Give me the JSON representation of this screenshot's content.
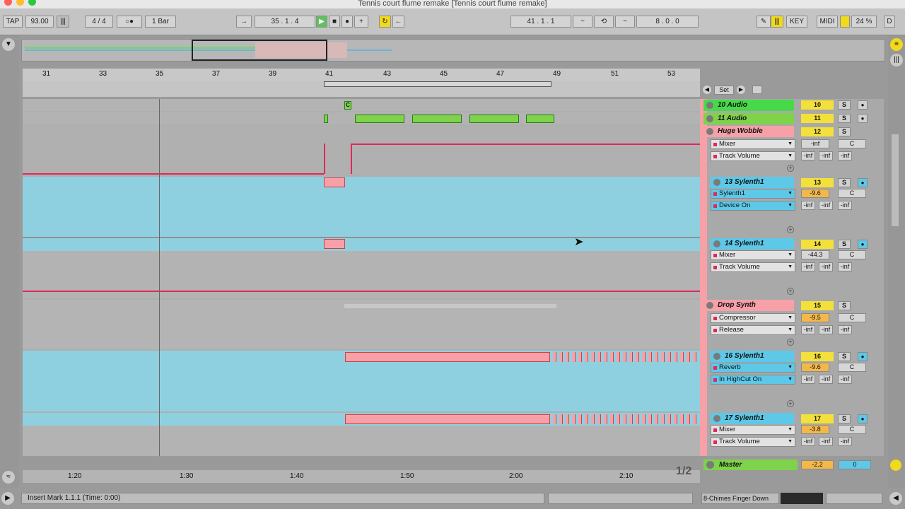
{
  "window": {
    "title": "Tennis court flume remake  [Tennis court flume remake]"
  },
  "transport": {
    "tap": "TAP",
    "tempo": "93.00",
    "signature": "4 / 4",
    "quantize": "1 Bar",
    "position": "35 .  1 .  4",
    "loop_start": "41 .  1 .  1",
    "loop_length": "8 .  0 .  0",
    "key": "KEY",
    "midi": "MIDI",
    "cpu": "24 %",
    "d": "D"
  },
  "ruler": {
    "bars": [
      "31",
      "33",
      "35",
      "37",
      "39",
      "41",
      "43",
      "45",
      "47",
      "49",
      "51",
      "53"
    ]
  },
  "timeline": {
    "times": [
      "1:20",
      "1:30",
      "1:40",
      "1:50",
      "2:00",
      "2:10"
    ],
    "page": "1/2"
  },
  "locators": {
    "set": "Set"
  },
  "tracks": [
    {
      "name": "10 Audio",
      "num": "10"
    },
    {
      "name": "11 Audio",
      "num": "11"
    },
    {
      "name": "Huge Wobble",
      "num": "12",
      "dev": "Mixer",
      "param": "Track Volume",
      "vol": "-inf",
      "pan": "C"
    },
    {
      "name": "13 Sylenth1",
      "num": "13",
      "dev": "Sylenth1",
      "param": "Device On",
      "vol": "-9.6",
      "pan": "C"
    },
    {
      "name": "14 Sylenth1",
      "num": "14",
      "dev": "Mixer",
      "param": "Track Volume",
      "vol": "-44.3",
      "pan": "C"
    },
    {
      "name": "Drop Synth",
      "num": "15",
      "dev": "Compressor",
      "param": "Release",
      "vol": "-9.5",
      "pan": "C"
    },
    {
      "name": "16 Sylenth1",
      "num": "16",
      "dev": "Reverb",
      "param": "In HighCut On",
      "vol": "-9.6",
      "pan": "C"
    },
    {
      "name": "17 Sylenth1",
      "num": "17",
      "dev": "Mixer",
      "param": "Track Volume",
      "vol": "-3.8",
      "pan": "C"
    }
  ],
  "inf": "-inf",
  "solo": "S",
  "master": {
    "name": "Master",
    "vol": "-2.2",
    "val": "0"
  },
  "clip_letter": "C",
  "status": {
    "message": "Insert Mark 1.1.1 (Time: 0:00)",
    "device": "8-Chimes Finger Down"
  }
}
